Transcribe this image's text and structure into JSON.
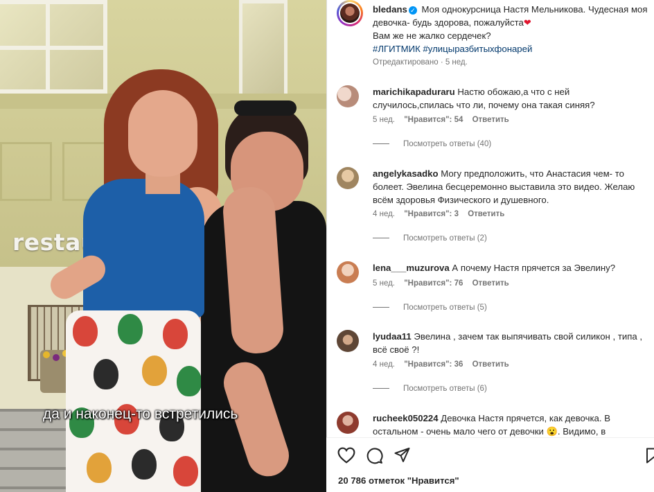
{
  "media": {
    "sign_text": "restaur",
    "subtitle": "да и наконец-то встретились"
  },
  "post": {
    "username": "bledans",
    "caption_line1": "Моя однокурсница Настя Мельникова. Чудесная моя девочка- будь здорова, пожалуйста",
    "caption_line2": "Вам же не жалко сердечек?",
    "hashtags": "#ЛГИТМИК #улицыразбитыхфонарей",
    "edited": "Отредактировано · 5 нед."
  },
  "comments": [
    {
      "username": "marichikapaduraru",
      "text": "Настю обожаю,а что с ней случилось,спилась что ли, почему она такая синяя?",
      "time": "5 нед.",
      "likes": "\"Нравится\": 54",
      "reply": "Ответить",
      "replies": "Посмотреть ответы (40)",
      "avatar_color": "#d7b1a2"
    },
    {
      "username": "angelykasadko",
      "text": "Могу предположить, что Анастасия чем- то болеет. Эвелина бесцеремонно выставила это видео. Желаю всём здоровья Физического и душевного.",
      "time": "4 нед.",
      "likes": "\"Нравится\": 3",
      "reply": "Ответить",
      "replies": "Посмотреть ответы (2)",
      "avatar_color": "#b89f7a"
    },
    {
      "username": "lena___muzurova",
      "text": "А почему Настя прячется за Эвелину?",
      "time": "5 нед.",
      "likes": "\"Нравится\": 76",
      "reply": "Ответить",
      "replies": "Посмотреть ответы (5)",
      "avatar_color": "#d99a72"
    },
    {
      "username": "lyudaa11",
      "text": "Эвелина , зачем так выпячивать свой силикон , типа , всё своё ?!",
      "time": "4 нед.",
      "likes": "\"Нравится\": 36",
      "reply": "Ответить",
      "replies": "Посмотреть ответы (6)",
      "avatar_color": "#7a5c45"
    },
    {
      "username": "rucheek050224",
      "text": "Девочка Настя прячется, как девочка. В остальном - очень мало чего от девочки 😮. Видимо, в",
      "avatar_color": "#b35a4a"
    }
  ],
  "actions": {
    "like_icon": "heart-outline-icon",
    "comment_icon": "comment-icon",
    "share_icon": "share-icon",
    "save_icon": "bookmark-icon"
  },
  "likes_count": "20 786 отметок \"Нравится\"",
  "colors": {
    "link": "#00376b",
    "meta": "#737373",
    "verified": "#0095f6",
    "heart": "#e0142e"
  }
}
